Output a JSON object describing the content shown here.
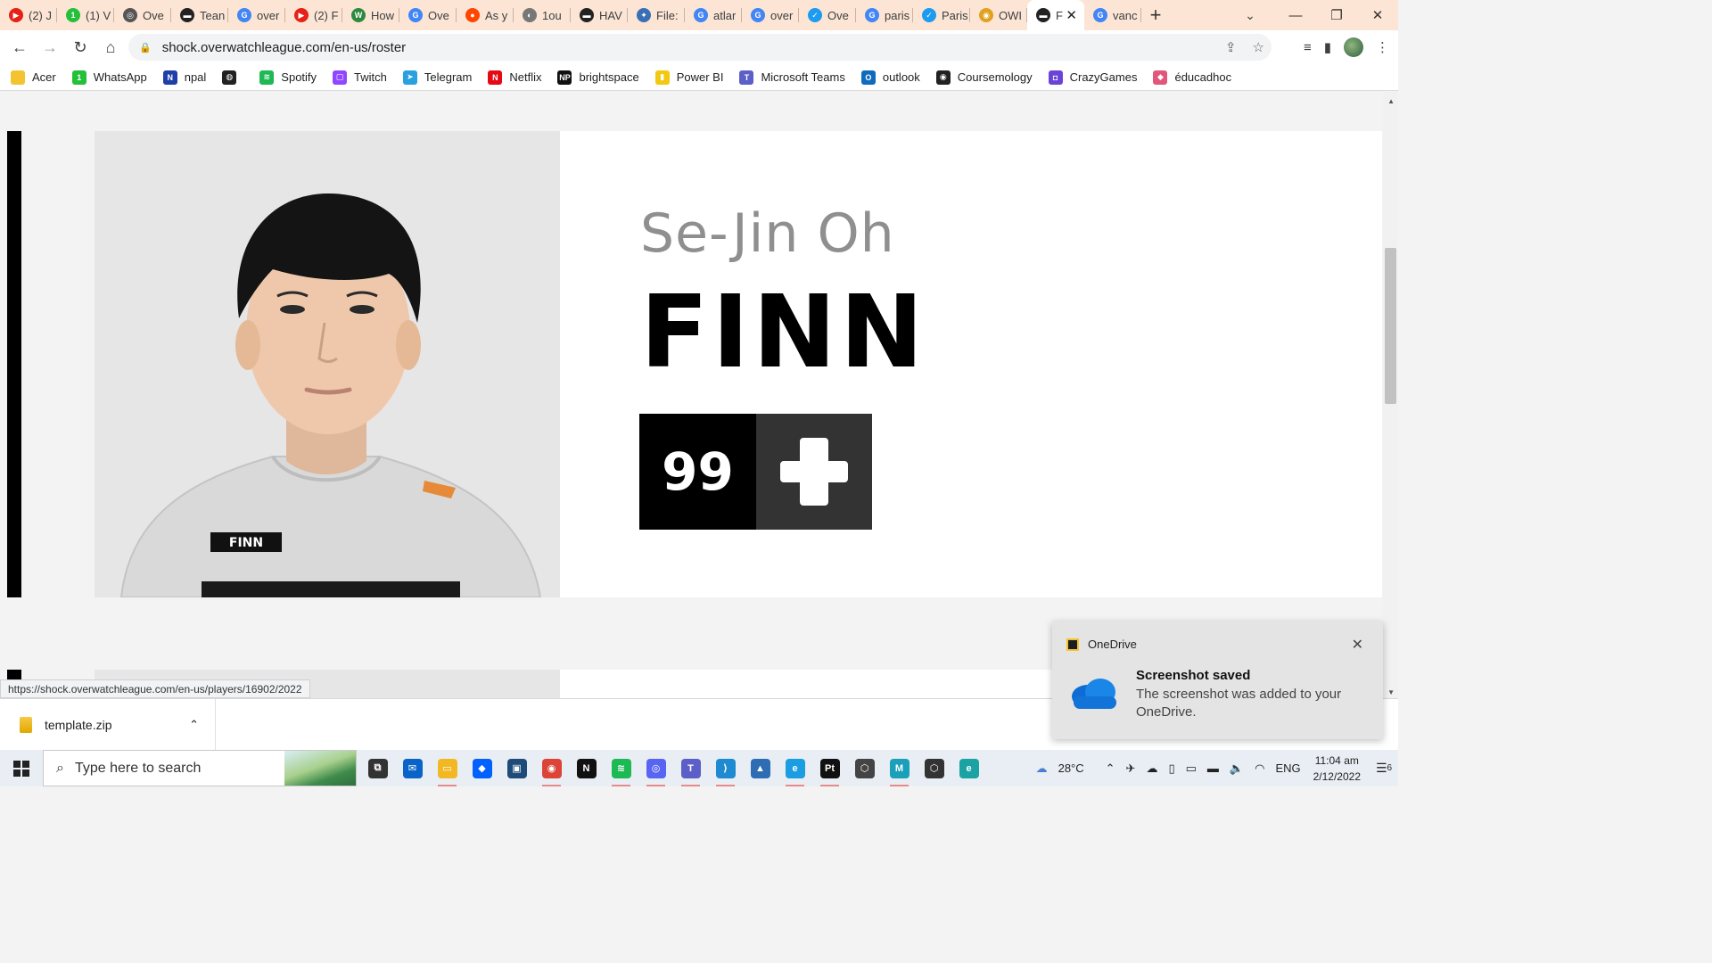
{
  "browser": {
    "tabs": [
      {
        "label": "(2) J",
        "color": "#e62117",
        "glyph": "▶"
      },
      {
        "label": "(1) V",
        "color": "#25c03a",
        "glyph": "1"
      },
      {
        "label": "Ove",
        "color": "#555555",
        "glyph": "◎"
      },
      {
        "label": "Tean",
        "color": "#222222",
        "glyph": "▬"
      },
      {
        "label": "over",
        "color": "#4285f4",
        "glyph": "G"
      },
      {
        "label": "(2) F",
        "color": "#e62117",
        "glyph": "▶"
      },
      {
        "label": "How",
        "color": "#2b8a3e",
        "glyph": "W"
      },
      {
        "label": "Ove",
        "color": "#4285f4",
        "glyph": "G"
      },
      {
        "label": "As y",
        "color": "#ff4500",
        "glyph": "●"
      },
      {
        "label": "1ou",
        "color": "#777777",
        "glyph": "◐"
      },
      {
        "label": "HAV",
        "color": "#222222",
        "glyph": "▬"
      },
      {
        "label": "File:",
        "color": "#3a6fb5",
        "glyph": "✦"
      },
      {
        "label": "atlar",
        "color": "#4285f4",
        "glyph": "G"
      },
      {
        "label": "over",
        "color": "#4285f4",
        "glyph": "G"
      },
      {
        "label": "Ove",
        "color": "#1d9bf0",
        "glyph": "✓"
      },
      {
        "label": "paris",
        "color": "#4285f4",
        "glyph": "G"
      },
      {
        "label": "Paris",
        "color": "#1d9bf0",
        "glyph": "✓"
      },
      {
        "label": "OWI",
        "color": "#e0a020",
        "glyph": "◉"
      },
      {
        "label": "F",
        "color": "#222222",
        "glyph": "▬",
        "active": true
      },
      {
        "label": "vanc",
        "color": "#4285f4",
        "glyph": "G"
      }
    ],
    "url": "shock.overwatchleague.com/en-us/roster",
    "status_url": "https://shock.overwatchleague.com/en-us/players/16902/2022",
    "bookmarks": [
      {
        "label": "Acer",
        "color": "#f4c430",
        "glyph": ""
      },
      {
        "label": "WhatsApp",
        "color": "#25c03a",
        "glyph": "1"
      },
      {
        "label": "npal",
        "color": "#1f3fa8",
        "glyph": "N"
      },
      {
        "label": "",
        "color": "#222222",
        "glyph": "◍"
      },
      {
        "label": "Spotify",
        "color": "#1db954",
        "glyph": "≋"
      },
      {
        "label": "Twitch",
        "color": "#9146ff",
        "glyph": "▢"
      },
      {
        "label": "Telegram",
        "color": "#2aa1de",
        "glyph": "➤"
      },
      {
        "label": "Netflix",
        "color": "#e50914",
        "glyph": "N"
      },
      {
        "label": "brightspace",
        "color": "#111111",
        "glyph": "NP"
      },
      {
        "label": "Power BI",
        "color": "#f2c811",
        "glyph": "▮"
      },
      {
        "label": "Microsoft Teams",
        "color": "#5b5fc7",
        "glyph": "T"
      },
      {
        "label": "outlook",
        "color": "#0f6cbd",
        "glyph": "O"
      },
      {
        "label": "Coursemology",
        "color": "#222222",
        "glyph": "◉"
      },
      {
        "label": "CrazyGames",
        "color": "#6b43d6",
        "glyph": "◘"
      },
      {
        "label": "éducadhoc",
        "color": "#e0577a",
        "glyph": "◆"
      }
    ]
  },
  "player": {
    "real_name": "Se-Jin Oh",
    "handle": "FINN",
    "number": "99",
    "role_icon": "support-plus-icon",
    "shirt_name": "FINN"
  },
  "downloads": {
    "file": "template.zip"
  },
  "toast": {
    "app": "OneDrive",
    "title": "Screenshot saved",
    "body": "The screenshot was added to your OneDrive."
  },
  "taskbar": {
    "search_placeholder": "Type here to search",
    "weather": "28°C",
    "lang": "ENG",
    "time": "11:04 am",
    "date": "2/12/2022",
    "notif_count": "6",
    "apps": [
      {
        "name": "task-view",
        "color": "#333333",
        "glyph": "⧉",
        "open": false
      },
      {
        "name": "mail",
        "color": "#0a64c8",
        "glyph": "✉",
        "open": false
      },
      {
        "name": "file-explorer",
        "color": "#f2b824",
        "glyph": "▭",
        "open": true
      },
      {
        "name": "dropbox",
        "color": "#0061fe",
        "glyph": "◆",
        "open": false
      },
      {
        "name": "store",
        "color": "#1e4b7a",
        "glyph": "▣",
        "open": false
      },
      {
        "name": "chrome",
        "color": "#db4437",
        "glyph": "◉",
        "open": true
      },
      {
        "name": "netflix",
        "color": "#111111",
        "glyph": "N",
        "open": false
      },
      {
        "name": "spotify",
        "color": "#1db954",
        "glyph": "≋",
        "open": true
      },
      {
        "name": "discord",
        "color": "#5865f2",
        "glyph": "◎",
        "open": true
      },
      {
        "name": "teams",
        "color": "#5b5fc7",
        "glyph": "T",
        "open": true
      },
      {
        "name": "vscode",
        "color": "#1f8ad2",
        "glyph": "⟩",
        "open": true
      },
      {
        "name": "photos",
        "color": "#2e6db4",
        "glyph": "▲",
        "open": false
      },
      {
        "name": "edge",
        "color": "#1b9de2",
        "glyph": "e",
        "open": true
      },
      {
        "name": "pycharm",
        "color": "#111111",
        "glyph": "Pt",
        "open": true
      },
      {
        "name": "unity",
        "color": "#444444",
        "glyph": "⬡",
        "open": false
      },
      {
        "name": "maya",
        "color": "#1aa0b8",
        "glyph": "M",
        "open": true
      },
      {
        "name": "unity-hub",
        "color": "#333333",
        "glyph": "⬡",
        "open": false
      },
      {
        "name": "edge-dev",
        "color": "#1ba3a3",
        "glyph": "e",
        "open": false
      }
    ]
  }
}
